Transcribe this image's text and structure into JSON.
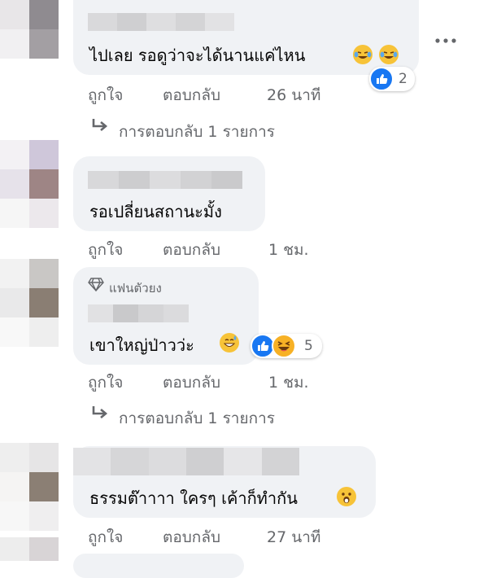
{
  "comments": [
    {
      "text": "ไปเลย รอดูว่าจะได้นานแค่ไหน",
      "actions": {
        "like": "ถูกใจ",
        "reply": "ตอบกลับ",
        "time": "26 นาที"
      },
      "reaction_count": "2",
      "replies_label": "การตอบกลับ 1 รายการ"
    },
    {
      "text": "รอเปลี่ยนสถานะมั้ง",
      "actions": {
        "like": "ถูกใจ",
        "reply": "ตอบกลับ",
        "time": "1 ชม."
      }
    },
    {
      "badge": "แฟนตัวยง",
      "text": "เขาใหญ่ป่าวว่ะ",
      "actions": {
        "like": "ถูกใจ",
        "reply": "ตอบกลับ",
        "time": "1 ชม."
      },
      "reaction_count": "5",
      "replies_label": "การตอบกลับ 1 รายการ"
    },
    {
      "text": "ธรรมต๊าาาา ใครๆ เค้าก็ทำกัน",
      "actions": {
        "like": "ถูกใจ",
        "reply": "ตอบกลับ",
        "time": "27 นาที"
      }
    }
  ],
  "icons": {
    "more": "more-horizontal-icon",
    "reply_arrow": "reply-arrow-icon",
    "badge": "diamond-icon",
    "like": "like-reaction-icon",
    "laugh": "laugh-reaction-icon",
    "sweat": "sweat-smile-emoji",
    "tears": "tears-of-joy-emoji"
  },
  "colors": {
    "bubble": "#f0f2f5",
    "like_blue": "#1877f2",
    "muted": "#65676b",
    "laugh_yellow": "#f7b125"
  }
}
